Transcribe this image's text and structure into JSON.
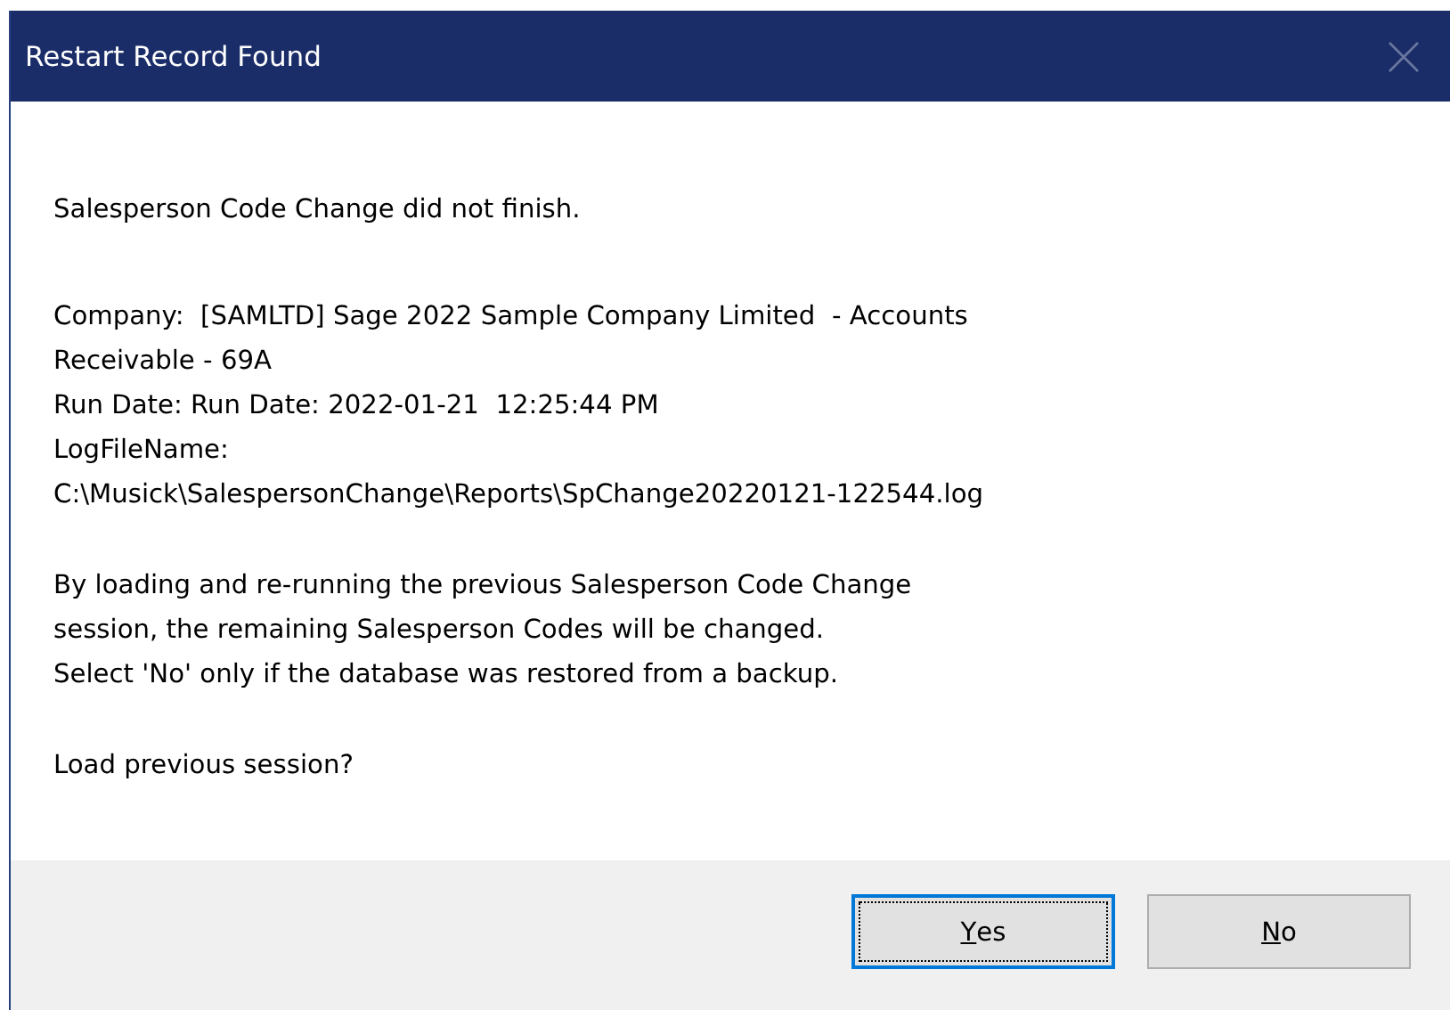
{
  "window": {
    "title": "Restart Record Found",
    "close_disabled": true
  },
  "message": [
    [
      "Salesperson Code Change did not finish."
    ],
    [
      "Company:  [SAMLTD] Sage 2022 Sample Company Limited  - Accounts",
      "Receivable - 69A",
      "Run Date: Run Date: 2022-01-21  12:25:44 PM",
      "LogFileName:",
      "C:\\Musick\\SalespersonChange\\Reports\\SpChange20220121-122544.log"
    ],
    [
      "By loading and re-running the previous Salesperson Code Change",
      "session, the remaining Salesperson Codes will be changed.",
      "Select 'No' only if the database was restored from a backup."
    ],
    [
      "Load previous session?"
    ]
  ],
  "buttons": [
    {
      "label": "Yes",
      "focused": true
    },
    {
      "label": "No",
      "focused": false
    }
  ]
}
